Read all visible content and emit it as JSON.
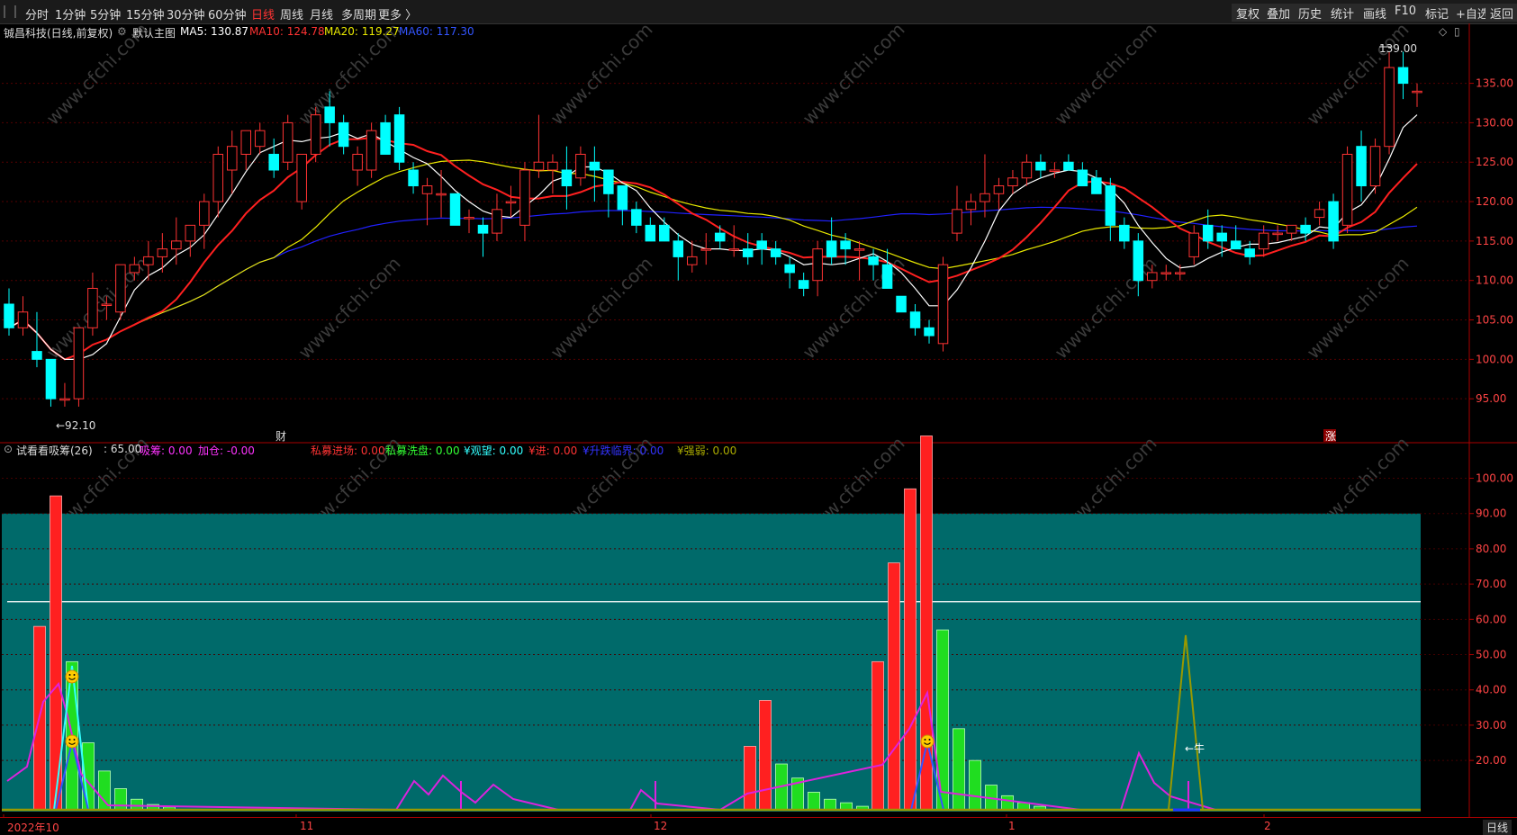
{
  "toolbar": {
    "periods": [
      "分时",
      "1分钟",
      "5分钟",
      "15分钟",
      "30分钟",
      "60分钟",
      "日线",
      "周线",
      "月线",
      "多周期",
      "更多 〉"
    ],
    "active_period": "日线",
    "right_buttons": [
      "复权",
      "叠加",
      "历史",
      "统计",
      "画线",
      "F10",
      "标记",
      "+自选",
      "返回"
    ]
  },
  "main_legend": {
    "stock": "铖昌科技(日线,前复权)",
    "chart_name": "默认主图",
    "ma5": "MA5: 130.87",
    "ma10": "MA10: 124.78",
    "ma20": "MA20: 119.27",
    "ma60": "MA60: 117.30"
  },
  "sub_legend": {
    "name": "试看看吸筹(26)",
    "value": ": 65.00",
    "items": [
      {
        "text": "吸筹: 0.00",
        "color": "#ff33ff"
      },
      {
        "text": "加仓: -0.00",
        "color": "#ff33ff"
      },
      {
        "text": "私募进场: 0.00",
        "color": "#ff3333"
      },
      {
        "text": "私募洗盘: 0.00",
        "color": "#33ff33"
      },
      {
        "text": "¥观望: 0.00",
        "color": "#33ffff"
      },
      {
        "text": "¥进: 0.00",
        "color": "#ff3333"
      },
      {
        "text": "¥升跌临界: 0.00",
        "color": "#3333ff"
      },
      {
        "text": "¥强弱: 0.00",
        "color": "#aaaa00"
      }
    ]
  },
  "annotations": {
    "high": "139.00",
    "low": "92.10",
    "cai": "财",
    "zhang": "涨",
    "niu": "←牛"
  },
  "price_axis": [
    "135.00",
    "130.00",
    "125.00",
    "120.00",
    "115.00",
    "110.00",
    "105.00",
    "100.00",
    "95.00"
  ],
  "sub_axis": [
    "100.00",
    "90.00",
    "80.00",
    "70.00",
    "60.00",
    "50.00",
    "40.00",
    "30.00",
    "20.00"
  ],
  "date_axis": [
    "2022年10",
    "11",
    "12",
    "1",
    "2"
  ],
  "bottom_right": "日线",
  "watermark": "www.cfchi.com",
  "colors": {
    "up": "#ff3333",
    "down": "#00ffff",
    "ma5": "#ffffff",
    "ma10": "#ff2020",
    "ma20": "#e8e800",
    "ma60": "#2020ff",
    "teal": "#006a6a"
  },
  "chart_data": {
    "type": "candlestick",
    "ohlc": [
      [
        107,
        109,
        103,
        104
      ],
      [
        104,
        108,
        103,
        106
      ],
      [
        101,
        106,
        99,
        100
      ],
      [
        100,
        100,
        94,
        95
      ],
      [
        95,
        97,
        94,
        95
      ],
      [
        95,
        104,
        94,
        104
      ],
      [
        104,
        111,
        103,
        109
      ],
      [
        107,
        108,
        105,
        107
      ],
      [
        106,
        112,
        105,
        112
      ],
      [
        111,
        113,
        110,
        112
      ],
      [
        112,
        115,
        110,
        113
      ],
      [
        113,
        116,
        111,
        114
      ],
      [
        114,
        118,
        112,
        115
      ],
      [
        115,
        117,
        113,
        117
      ],
      [
        117,
        121,
        114,
        120
      ],
      [
        120,
        127,
        118,
        126
      ],
      [
        124,
        129,
        121,
        127
      ],
      [
        126,
        129,
        124,
        129
      ],
      [
        127,
        130,
        126,
        129
      ],
      [
        126,
        128,
        123,
        124
      ],
      [
        125,
        131,
        124,
        130
      ],
      [
        120,
        126,
        119,
        126
      ],
      [
        126,
        132,
        125,
        131
      ],
      [
        132,
        134,
        127,
        130
      ],
      [
        130,
        131,
        126,
        127
      ],
      [
        124,
        127,
        122,
        126
      ],
      [
        124,
        130,
        123,
        129
      ],
      [
        130,
        131,
        126,
        126
      ],
      [
        131,
        132,
        124,
        125
      ],
      [
        124,
        125,
        121,
        122
      ],
      [
        121,
        123,
        117,
        122
      ],
      [
        121,
        124,
        118,
        121
      ],
      [
        121,
        121,
        117,
        117
      ],
      [
        118,
        119,
        116,
        118
      ],
      [
        117,
        118,
        113,
        116
      ],
      [
        116,
        121,
        115,
        119
      ],
      [
        120,
        122,
        118,
        120
      ],
      [
        117,
        125,
        115,
        124
      ],
      [
        124,
        131,
        123,
        125
      ],
      [
        124,
        126,
        121,
        125
      ],
      [
        124,
        127,
        119,
        122
      ],
      [
        123,
        127,
        122,
        126
      ],
      [
        125,
        127,
        120,
        124
      ],
      [
        124,
        124,
        118,
        121
      ],
      [
        122,
        122,
        117,
        119
      ],
      [
        119,
        120,
        116,
        117
      ],
      [
        117,
        118,
        115,
        115
      ],
      [
        117,
        118,
        115,
        115
      ],
      [
        115,
        116,
        110,
        113
      ],
      [
        112,
        115,
        111,
        113
      ],
      [
        114,
        116,
        112,
        114
      ],
      [
        116,
        117,
        114,
        115
      ],
      [
        114,
        117,
        113,
        114
      ],
      [
        114,
        116,
        112,
        113
      ],
      [
        115,
        116,
        112,
        114
      ],
      [
        114,
        115,
        112,
        113
      ],
      [
        112,
        113,
        109,
        111
      ],
      [
        110,
        111,
        108,
        109
      ],
      [
        110,
        115,
        108,
        114
      ],
      [
        115,
        118,
        112,
        113
      ],
      [
        115,
        116,
        112,
        114
      ],
      [
        114,
        115,
        110,
        114
      ],
      [
        113,
        114,
        110,
        112
      ],
      [
        112,
        114,
        109,
        109
      ],
      [
        108,
        108,
        106,
        106
      ],
      [
        106,
        107,
        103,
        104
      ],
      [
        104,
        105,
        102,
        103
      ],
      [
        102,
        113,
        101,
        112
      ],
      [
        116,
        122,
        115,
        119
      ],
      [
        119,
        121,
        117,
        120
      ],
      [
        120,
        126,
        118,
        121
      ],
      [
        121,
        123,
        119,
        122
      ],
      [
        122,
        124,
        121,
        123
      ],
      [
        123,
        126,
        122,
        125
      ],
      [
        125,
        126,
        123,
        124
      ],
      [
        124,
        125,
        123,
        124
      ],
      [
        125,
        126,
        124,
        124
      ],
      [
        124,
        125,
        122,
        122
      ],
      [
        123,
        124,
        121,
        121
      ],
      [
        122,
        123,
        115,
        117
      ],
      [
        117,
        118,
        114,
        115
      ],
      [
        115,
        116,
        108,
        110
      ],
      [
        110,
        112,
        109,
        111
      ],
      [
        111,
        112,
        110,
        111
      ],
      [
        111,
        112,
        110,
        111
      ],
      [
        113,
        117,
        112,
        116
      ],
      [
        117,
        119,
        114,
        115
      ],
      [
        116,
        117,
        113,
        115
      ],
      [
        115,
        117,
        114,
        114
      ],
      [
        114,
        115,
        112,
        113
      ],
      [
        114,
        117,
        113,
        116
      ],
      [
        116,
        117,
        115,
        116
      ],
      [
        116,
        117,
        115,
        117
      ],
      [
        117,
        118,
        115,
        116
      ],
      [
        118,
        120,
        117,
        119
      ],
      [
        120,
        121,
        114,
        115
      ],
      [
        117,
        127,
        116,
        126
      ],
      [
        127,
        129,
        120,
        122
      ],
      [
        122,
        128,
        121,
        127
      ],
      [
        127,
        139,
        126,
        137
      ],
      [
        137,
        139,
        133,
        135
      ],
      [
        134,
        135,
        132,
        134
      ]
    ]
  }
}
